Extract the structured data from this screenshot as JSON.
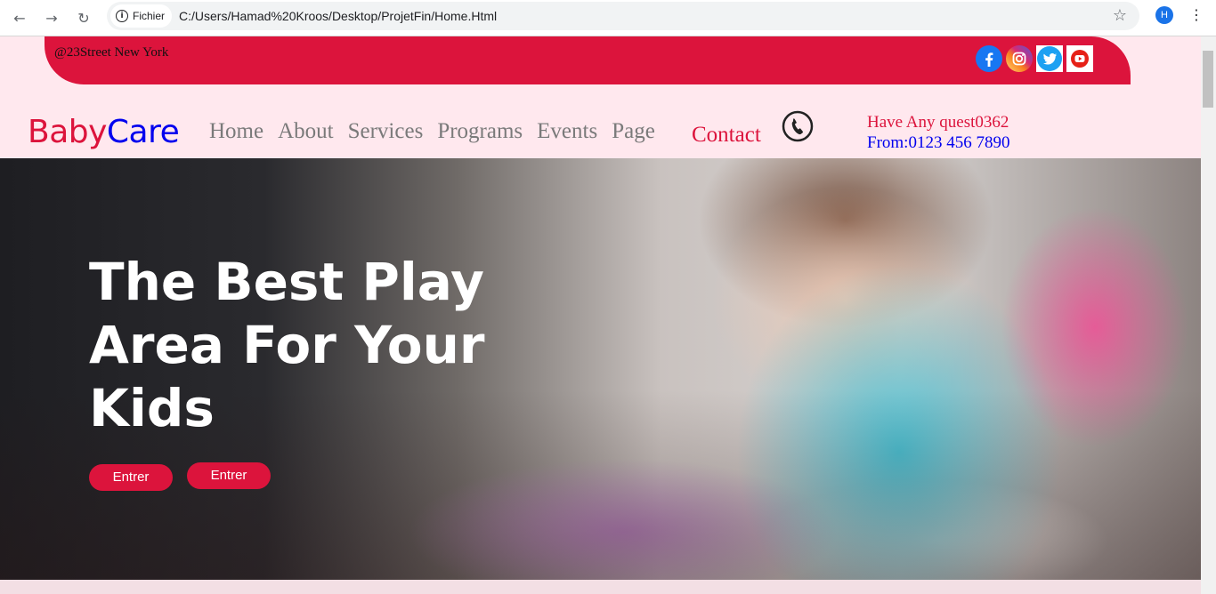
{
  "browser": {
    "site_chip": "Fichier",
    "url": "C:/Users/Hamad%20Kroos/Desktop/ProjetFin/Home.Html",
    "profile_initial": "H"
  },
  "topbar": {
    "address": "@23Street New York",
    "color": "#dc143c",
    "socials": [
      "facebook-icon",
      "instagram-icon",
      "twitter-icon",
      "youtube-icon"
    ]
  },
  "nav": {
    "logo_part1": "Baby",
    "logo_part2": "Care",
    "items": [
      "Home",
      "About",
      "Services",
      "Programs",
      "Events",
      "Page"
    ],
    "contact": "Contact",
    "quest": "Have Any quest0362",
    "phone": "From:0123 456 7890"
  },
  "hero": {
    "title": "The Best Play Area For Your Kids",
    "buttons": [
      "Entrer",
      "Entrer"
    ]
  }
}
